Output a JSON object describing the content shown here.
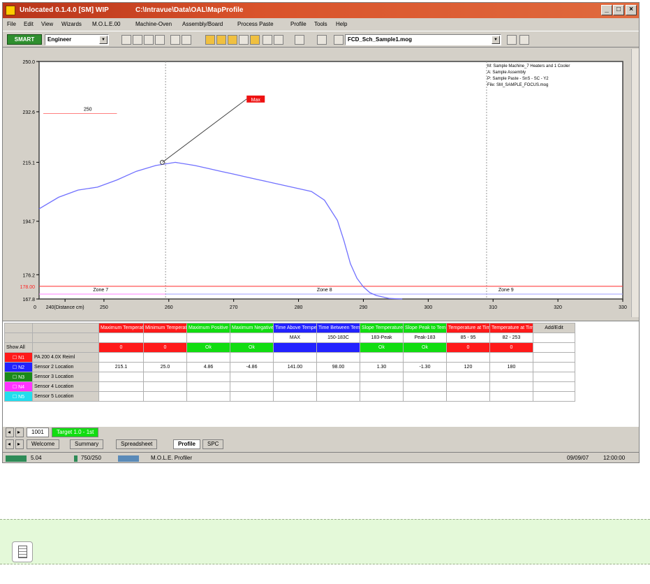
{
  "window": {
    "title": "Unlocated 0.1.4.0 [SM] WIP",
    "path": "C:\\Intravue\\Data\\OAL\\MapProfile"
  },
  "menu": [
    "File",
    "Edit",
    "View",
    "Wizards",
    "M.O.L.E.00",
    "Machine-Oven",
    "Assembly/Board",
    "Process Paste",
    "Profile",
    "Tools",
    "Help"
  ],
  "toolbar": {
    "logo": "SMART",
    "user_level": "Engineer",
    "file_select": "FCD_Sch_Sample1.mog"
  },
  "chart_data": {
    "type": "line",
    "y_ticks": [
      "250.0",
      "232.6",
      "215.1",
      "194.7",
      "176.2",
      "167.8"
    ],
    "x_ticks": [
      "240(Distance cm)",
      "250",
      "260",
      "270",
      "280",
      "290",
      "300",
      "310",
      "320",
      "330"
    ],
    "left_marker": "178.00",
    "upper_label": "250",
    "peak_label": "Max",
    "zones": [
      "Zone 7",
      "Zone 8",
      "Zone 9"
    ],
    "legend": [
      "M: Sample Machine_7 Heaters and 1 Cooler",
      "A: Sample Assembly",
      "P: Sample Paste - SnS - SC - Y2",
      "File: SM_SAMPLE_FOCUS.mog"
    ],
    "x": [
      240,
      243,
      246,
      249,
      252,
      255,
      258,
      261,
      264,
      266,
      268,
      270,
      272,
      274,
      276,
      278,
      280,
      282,
      284,
      286,
      287,
      288,
      289,
      290,
      291,
      292,
      293,
      294,
      295,
      296
    ],
    "y": [
      199,
      203,
      205.5,
      206.5,
      209,
      212,
      214,
      215.1,
      214,
      213,
      212,
      211,
      210,
      209,
      208,
      207,
      206,
      205,
      202,
      195,
      188,
      180,
      175,
      172,
      170,
      169,
      168.5,
      168,
      167.9,
      167.8
    ],
    "ylim": [
      167.8,
      250
    ],
    "xlim": [
      240,
      330
    ]
  },
  "grid": {
    "headers": [
      {
        "label": "Maximum Temperature",
        "color": "#ff1a1a"
      },
      {
        "label": "Minimum Temperature",
        "color": "#ff1a1a"
      },
      {
        "label": "Maximum Positive Slope",
        "color": "#11dd11"
      },
      {
        "label": "Maximum Negative Slope",
        "color": "#11dd11"
      },
      {
        "label": "Time Above Temperature Reference Rising (s)",
        "color": "#2222ff"
      },
      {
        "label": "Time Between Temperature",
        "color": "#2222ff"
      },
      {
        "label": "Slope Temperature to Peak",
        "color": "#11dd11"
      },
      {
        "label": "Slope Peak to Temperature",
        "color": "#11dd11"
      },
      {
        "label": "Temperature at Time Reference",
        "color": "#ff1a1a"
      },
      {
        "label": "Temperature at Time Reference",
        "color": "#ff1a1a"
      },
      {
        "label": "Add/Edit",
        "color": "#d4d0c8"
      }
    ],
    "spec_row": [
      "",
      "",
      "",
      "",
      "MAX",
      "150-183C",
      "183-Peak",
      "Peak-183",
      "85 - 95",
      "82 - 253",
      ""
    ],
    "status_row": [
      {
        "t": "0",
        "c": "#ff1a1a"
      },
      {
        "t": "0",
        "c": "#ff1a1a"
      },
      {
        "t": "Ok",
        "c": "#11dd11"
      },
      {
        "t": "Ok",
        "c": "#11dd11"
      },
      {
        "t": "",
        "c": "#2222ff"
      },
      {
        "t": "",
        "c": "#2222ff"
      },
      {
        "t": "Ok",
        "c": "#11dd11"
      },
      {
        "t": "Ok",
        "c": "#11dd11"
      },
      {
        "t": "0",
        "c": "#ff1a1a"
      },
      {
        "t": "0",
        "c": "#ff1a1a"
      },
      {
        "t": "",
        "c": "#ffffff"
      }
    ],
    "show_all": "Show All",
    "rows": [
      {
        "tag": "N1",
        "color": "#ff1a1a",
        "name": "PA 200 4.0X Reiml",
        "values": [
          "",
          "",
          "",
          "",
          "",
          "",
          "",
          "",
          "",
          ""
        ]
      },
      {
        "tag": "N2",
        "color": "#2222ff",
        "name": "Sensor 2 Location",
        "values": [
          "215.1",
          "25.0",
          "4.86",
          "-4.86",
          "141.00",
          "98.00",
          "1.30",
          "-1.30",
          "120",
          "180"
        ]
      },
      {
        "tag": "N3",
        "color": "#1a8a1a",
        "name": "Sensor 3 Location",
        "values": [
          "",
          "",
          "",
          "",
          "",
          "",
          "",
          "",
          "",
          ""
        ]
      },
      {
        "tag": "N4",
        "color": "#ff33ff",
        "name": "Sensor 4 Location",
        "values": [
          "",
          "",
          "",
          "",
          "",
          "",
          "",
          "",
          "",
          ""
        ]
      },
      {
        "tag": "N5",
        "color": "#22ddee",
        "name": "Sensor 5 Location",
        "values": [
          "",
          "",
          "",
          "",
          "",
          "",
          "",
          "",
          "",
          ""
        ]
      }
    ]
  },
  "tabs1": [
    "1001",
    "Target 1.0 - 1st"
  ],
  "tabs2": [
    "Welcome",
    "Summary",
    "Spreadsheet",
    "Profile",
    "SPC"
  ],
  "status": {
    "s1": "5.04",
    "s2": "750/250",
    "s3": "M.O.L.E. Profiler",
    "date": "09/09/07",
    "time": "12:00:00"
  }
}
